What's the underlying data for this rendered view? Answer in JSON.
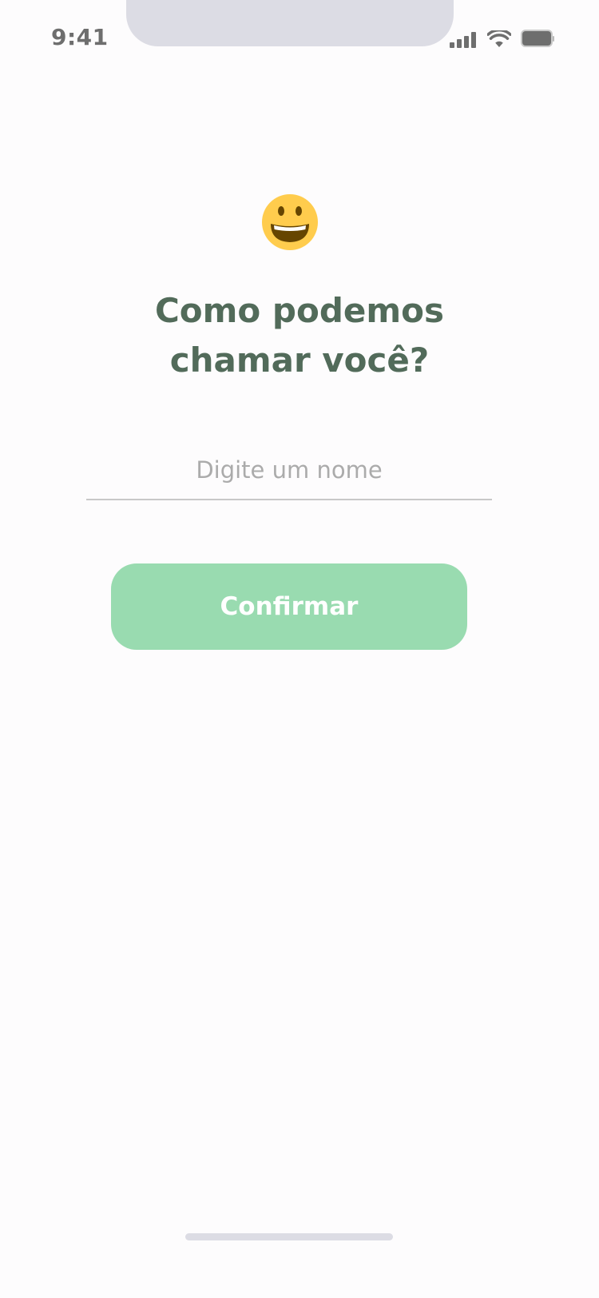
{
  "status_bar": {
    "time": "9:41",
    "icons": [
      "signal-icon",
      "wifi-icon",
      "battery-icon"
    ]
  },
  "emoji": {
    "icon": "grinning-face-icon",
    "colors": {
      "face": "#FFCC4D",
      "mouth": "#664500",
      "teeth": "#FFFFFF"
    }
  },
  "title": "Como podemos\nchamar você?",
  "name_input": {
    "value": "",
    "placeholder": "Digite um nome"
  },
  "confirm_button": {
    "label": "Confirmar"
  },
  "colors": {
    "background": "#FDFCFD",
    "title": "#526B5A",
    "button": "#99DBB0",
    "button_text": "#FFFFFF",
    "placeholder": "#ABABAB",
    "underline": "#C8C8C8",
    "notch": "#DCDCE4",
    "status": "#6E6E6E"
  }
}
